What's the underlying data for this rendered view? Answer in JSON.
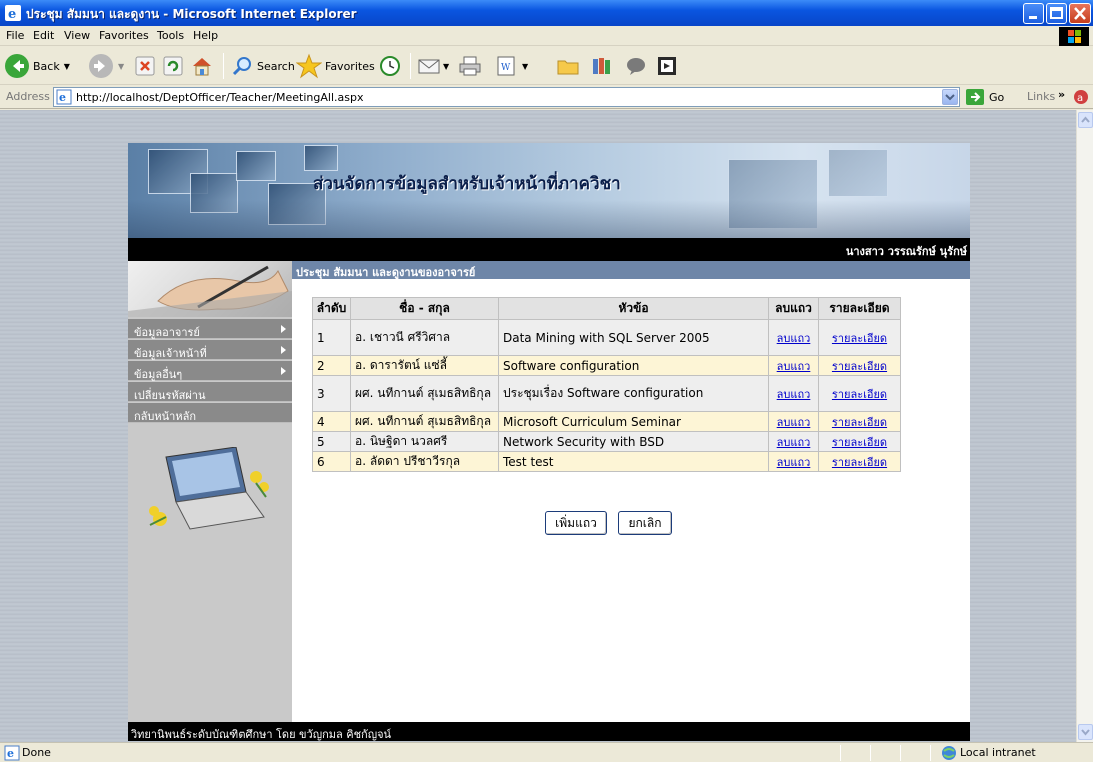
{
  "window": {
    "title": "ประชุม สัมมนา และดูงาน - Microsoft Internet Explorer"
  },
  "menu": [
    "File",
    "Edit",
    "View",
    "Favorites",
    "Tools",
    "Help"
  ],
  "toolbar": {
    "back_label": "Back",
    "search_label": "Search",
    "favorites_label": "Favorites"
  },
  "address": {
    "label": "Address",
    "url": "http://localhost/DeptOfficer/Teacher/MeetingAll.aspx",
    "go_label": "Go",
    "links_label": "Links"
  },
  "page": {
    "banner_title": "ส่วนจัดการข้อมูลสำหรับเจ้าหน้าที่ภาควิชา",
    "user_name": "นางสาว วรรณรักษ์ นุรักษ์",
    "section_title": "ประชุม สัมมนา และดูงานของอาจารย์",
    "footer": "วิทยานิพนธ์ระดับบัณฑิตศึกษา โดย ขวัญกมล คิชกัญจน์"
  },
  "nav": [
    {
      "label": "ข้อมูลอาจารย์",
      "has_submenu": true
    },
    {
      "label": "ข้อมูลเจ้าหน้าที่",
      "has_submenu": true
    },
    {
      "label": "ข้อมูลอื่นๆ",
      "has_submenu": true
    },
    {
      "label": "เปลี่ยนรหัสผ่าน",
      "has_submenu": false
    },
    {
      "label": "กลับหน้าหลัก",
      "has_submenu": false
    }
  ],
  "table": {
    "columns": [
      "ลำดับ",
      "ชื่อ - สกุล",
      "หัวข้อ",
      "ลบแถว",
      "รายละเอียด"
    ],
    "rows": [
      {
        "no": "1",
        "name": "อ. เชาวนี ศรีวิศาล",
        "topic": "Data Mining with SQL Server 2005",
        "delete": "ลบแถว",
        "detail": "รายละเอียด"
      },
      {
        "no": "2",
        "name": "อ. ดารารัตน์ แซ่ลี้",
        "topic": "Software configuration",
        "delete": "ลบแถว",
        "detail": "รายละเอียด"
      },
      {
        "no": "3",
        "name": "ผศ. นทีกานต์ สุเมธสิทธิกุล",
        "topic": "ประชุมเรื่อง Software configuration",
        "delete": "ลบแถว",
        "detail": "รายละเอียด"
      },
      {
        "no": "4",
        "name": "ผศ. นทีกานต์ สุเมธสิทธิกุล",
        "topic": "Microsoft Curriculum Seminar",
        "delete": "ลบแถว",
        "detail": "รายละเอียด"
      },
      {
        "no": "5",
        "name": "อ. นิษฐิดา นวลศรี",
        "topic": "Network Security with BSD",
        "delete": "ลบแถว",
        "detail": "รายละเอียด"
      },
      {
        "no": "6",
        "name": "อ. ลัดดา ปรีชาวีรกุล",
        "topic": "Test test",
        "delete": "ลบแถว",
        "detail": "รายละเอียด"
      }
    ]
  },
  "buttons": {
    "add_row": "เพิ่มแถว",
    "cancel": "ยกเลิก"
  },
  "status": {
    "text": "Done",
    "zone": "Local intranet"
  },
  "colors": {
    "xp_title": "#0a55e0",
    "nav_bg": "#8a8a8a",
    "section_header": "#6e86a8",
    "row_even": "#fdf5d6",
    "row_odd": "#eeeeee",
    "link": "#0000cc"
  }
}
